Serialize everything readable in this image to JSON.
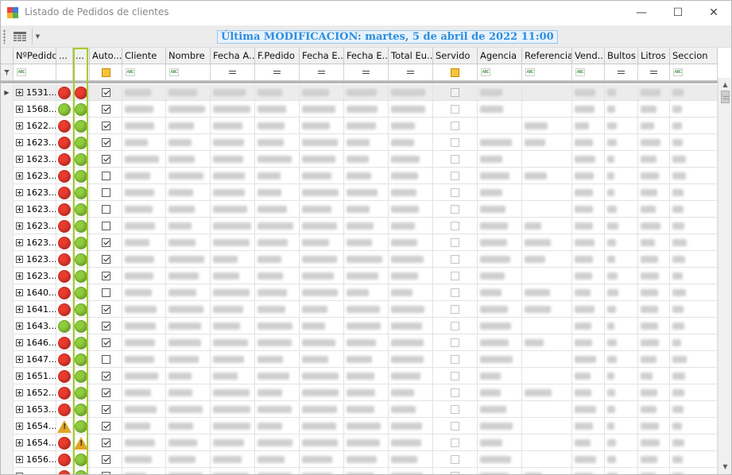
{
  "window": {
    "title": "Listado de Pedidos de clientes",
    "minimize_icon": "—",
    "maximize_icon": "☐",
    "close_icon": "✕"
  },
  "toolbar": {
    "layout_icon": "grid-layout-icon",
    "dropdown_icon": "▼",
    "banner": "Última MODIFICACION: martes, 5 de abril de 2022 11:00"
  },
  "columns": [
    "NºPedido",
    "...",
    "...",
    "Auto...",
    "Cliente",
    "Nombre",
    "Fecha A...",
    "F.Pedido",
    "Fecha E...",
    "Fecha E...",
    "Total Eu...",
    "Servido",
    "Agencia",
    "Referencia",
    "Vend...",
    "Bultos",
    "Litros",
    "Seccion"
  ],
  "filter_icons": [
    "abc",
    "",
    "",
    "check",
    "abc",
    "abc",
    "eq",
    "eq",
    "eq",
    "eq",
    "eq",
    "check",
    "abc",
    "abc",
    "abc",
    "eq",
    "eq",
    "abc"
  ],
  "filter_abc_label": "ABC",
  "row_indicator": "▶",
  "rows": [
    {
      "id": "1531...",
      "s1": "red",
      "s2": "red",
      "auto": true
    },
    {
      "id": "1568...",
      "s1": "green",
      "s2": "green",
      "auto": true
    },
    {
      "id": "1622...",
      "s1": "red",
      "s2": "green",
      "auto": true
    },
    {
      "id": "1623...",
      "s1": "red",
      "s2": "green",
      "auto": true
    },
    {
      "id": "1623...",
      "s1": "red",
      "s2": "green",
      "auto": true
    },
    {
      "id": "1623...",
      "s1": "red",
      "s2": "green",
      "auto": false
    },
    {
      "id": "1623...",
      "s1": "red",
      "s2": "green",
      "auto": false
    },
    {
      "id": "1623...",
      "s1": "red",
      "s2": "green",
      "auto": false
    },
    {
      "id": "1623...",
      "s1": "red",
      "s2": "green",
      "auto": false
    },
    {
      "id": "1623...",
      "s1": "red",
      "s2": "green",
      "auto": true
    },
    {
      "id": "1623...",
      "s1": "red",
      "s2": "green",
      "auto": true
    },
    {
      "id": "1623...",
      "s1": "red",
      "s2": "green",
      "auto": true
    },
    {
      "id": "1640...",
      "s1": "red",
      "s2": "green",
      "auto": false
    },
    {
      "id": "1641...",
      "s1": "red",
      "s2": "green",
      "auto": true
    },
    {
      "id": "1643...",
      "s1": "green",
      "s2": "green",
      "auto": true
    },
    {
      "id": "1646...",
      "s1": "red",
      "s2": "green",
      "auto": true
    },
    {
      "id": "1647...",
      "s1": "red",
      "s2": "green",
      "auto": false
    },
    {
      "id": "1651...",
      "s1": "red",
      "s2": "green",
      "auto": true
    },
    {
      "id": "1652...",
      "s1": "red",
      "s2": "green",
      "auto": true
    },
    {
      "id": "1653...",
      "s1": "red",
      "s2": "green",
      "auto": true
    },
    {
      "id": "1654...",
      "s1": "warn",
      "s2": "green",
      "auto": true
    },
    {
      "id": "1654...",
      "s1": "red",
      "s2": "warn",
      "auto": true
    },
    {
      "id": "1656...",
      "s1": "red",
      "s2": "green",
      "auto": true
    },
    {
      "id": "",
      "s1": "red",
      "s2": "green",
      "auto": true
    }
  ],
  "colors": {
    "highlight": "#a6cc2a",
    "banner_text": "#2d8ee0",
    "red": "#ea3b2f",
    "green": "#8fcc3e"
  },
  "scrollbar": {
    "up_icon": "▲",
    "down_icon": "▼"
  }
}
